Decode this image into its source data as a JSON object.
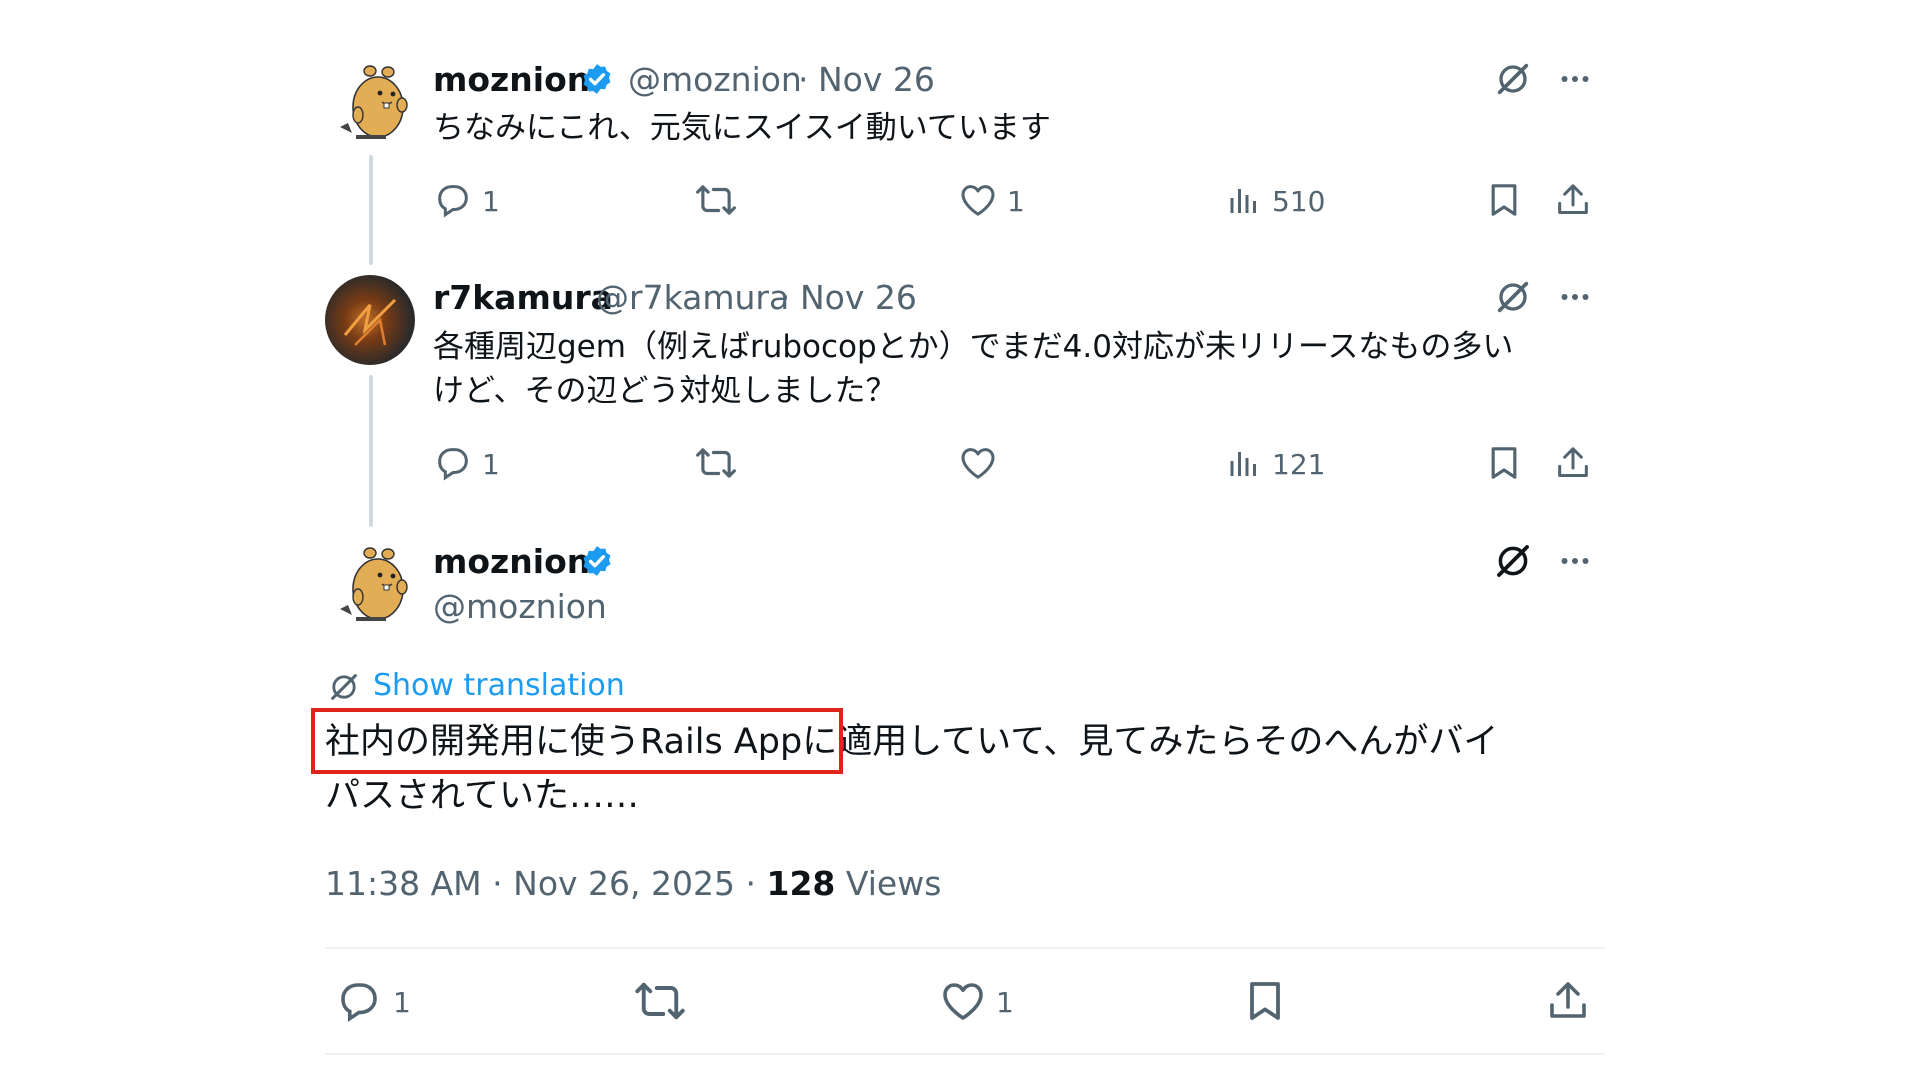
{
  "tweets": [
    {
      "name": "moznion",
      "handle": "@moznion",
      "sep": "·",
      "date": "Nov 26",
      "text": "ちなみにこれ、元気にスイスイ動いています",
      "reply_count": "1",
      "like_count": "1",
      "views": "510"
    },
    {
      "name": "r7kamura",
      "handle": "@r7kamura",
      "sep": "·",
      "date": "Nov 26",
      "text_line1": "各種周辺gem（例えばrubocopとか）でまだ4.0対応が未リリースなもの多い",
      "text_line2": "けど、その辺どう対処しました？",
      "reply_count": "1",
      "like_count": "",
      "views": "121"
    }
  ],
  "main_tweet": {
    "name": "moznion",
    "handle": "@moznion",
    "show_translation": "Show translation",
    "text_line1_highlighted": "社内の開発用に使うRails App",
    "text_line1_rest": "に適用していて、見てみたらそのへんがバイ",
    "text_line2": "パスされていた……",
    "time": "11:38 AM",
    "date": "Nov 26, 2025",
    "sep": "·",
    "views_count": "128",
    "views_label": "Views",
    "reply_count": "1",
    "like_count": "1"
  },
  "colors": {
    "text": "#0f1419",
    "secondary": "#536471",
    "link": "#1d9bf0",
    "verified": "#1d9bf0",
    "highlight_border": "#e0241b"
  },
  "icons": {
    "verified": "verified-badge-icon",
    "grok": "grok-icon",
    "more": "more-icon",
    "reply": "reply-icon",
    "retweet": "retweet-icon",
    "like": "like-icon",
    "views": "views-icon",
    "bookmark": "bookmark-icon",
    "share": "share-icon"
  }
}
